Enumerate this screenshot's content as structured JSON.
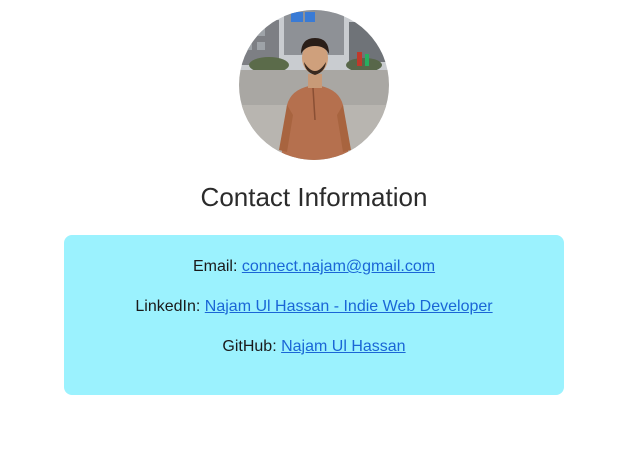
{
  "profile": {
    "photo_label": "profile-photo"
  },
  "heading": {
    "title": "Contact Information"
  },
  "contacts": [
    {
      "label": "Email:",
      "link_text": "connect.najam@gmail.com"
    },
    {
      "label": "LinkedIn:",
      "link_text": "Najam Ul Hassan - Indie Web Developer"
    },
    {
      "label": "GitHub:",
      "link_text": "Najam Ul Hassan"
    }
  ],
  "colors": {
    "card_background": "#9bf2fe",
    "link": "#1a66d6",
    "heading": "#2b2b2b"
  }
}
